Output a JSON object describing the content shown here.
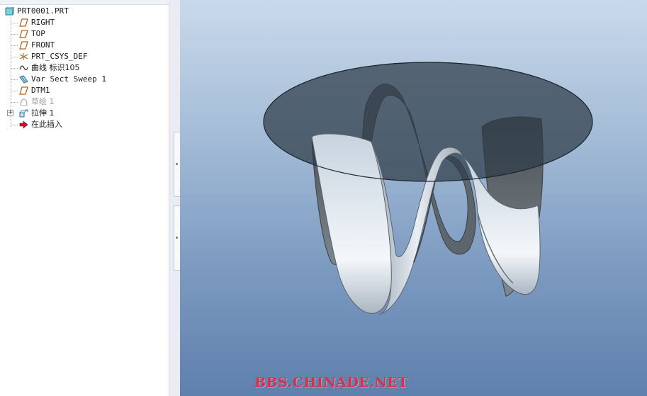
{
  "model_tree": {
    "root": {
      "label": "PRT0001.PRT",
      "icon": "part-icon"
    },
    "items": [
      {
        "label": "RIGHT",
        "icon": "datum-plane-icon"
      },
      {
        "label": "TOP",
        "icon": "datum-plane-icon"
      },
      {
        "label": "FRONT",
        "icon": "datum-plane-icon"
      },
      {
        "label": "PRT_CSYS_DEF",
        "icon": "coordinate-system-icon"
      },
      {
        "label": "曲线 标识105",
        "icon": "curve-icon"
      },
      {
        "label": "Var Sect Sweep 1",
        "icon": "sweep-icon"
      },
      {
        "label": "DTM1",
        "icon": "datum-plane-icon"
      },
      {
        "label": "草绘 1",
        "icon": "sketch-icon",
        "suppressed": true
      },
      {
        "label": "拉伸 1",
        "icon": "extrude-icon",
        "expandable": true
      },
      {
        "label": "在此插入",
        "icon": "insert-here-arrow-icon"
      }
    ]
  },
  "viewport": {
    "watermark": "BBS.CHINADE.NET",
    "background_top": "#c9d9ea",
    "background_bottom": "#5f7fad"
  },
  "colors": {
    "datum_plane": "#b5651d",
    "insert_arrow": "#c8102e",
    "watermark": "#d9304a"
  }
}
